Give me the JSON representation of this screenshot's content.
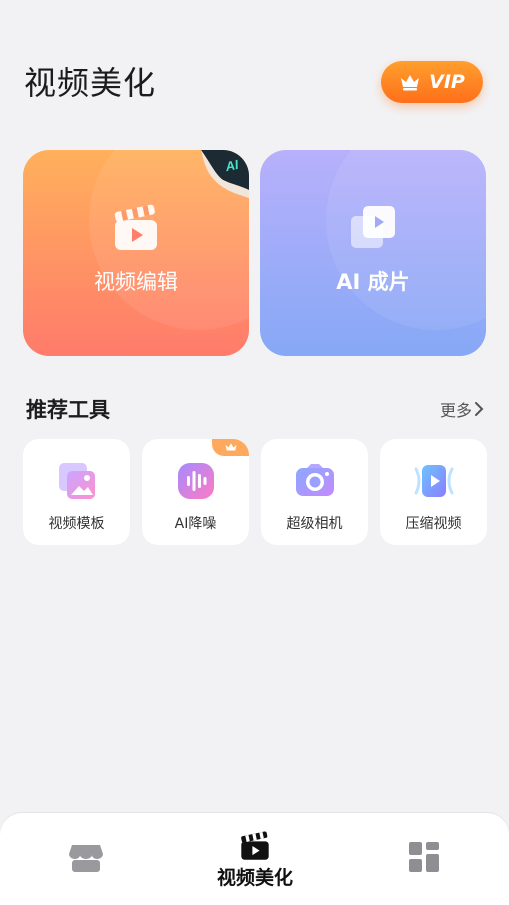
{
  "header": {
    "title": "视频美化",
    "vip_label": "VIP"
  },
  "cards": [
    {
      "label": "视频编辑",
      "corner_badge": "AI"
    },
    {
      "label": "AI 成片"
    }
  ],
  "recommended": {
    "title": "推荐工具",
    "more_label": "更多",
    "tools": [
      {
        "label": "视频模板",
        "icon": "image-template-icon"
      },
      {
        "label": "AI降噪",
        "icon": "sound-wave-icon",
        "badge": "crown-icon"
      },
      {
        "label": "超级相机",
        "icon": "camera-icon"
      },
      {
        "label": "压缩视频",
        "icon": "compress-video-icon"
      }
    ]
  },
  "tabbar": {
    "items": [
      {
        "icon": "store-icon"
      },
      {
        "icon": "clapperboard-icon",
        "label": "视频美化",
        "active": true
      },
      {
        "icon": "grid-icon"
      }
    ]
  },
  "colors": {
    "vip_orange": "#ff7a1e",
    "edit_card": "#ff9b63",
    "ai_card": "#9cacf8",
    "background": "#f2f2f4"
  }
}
